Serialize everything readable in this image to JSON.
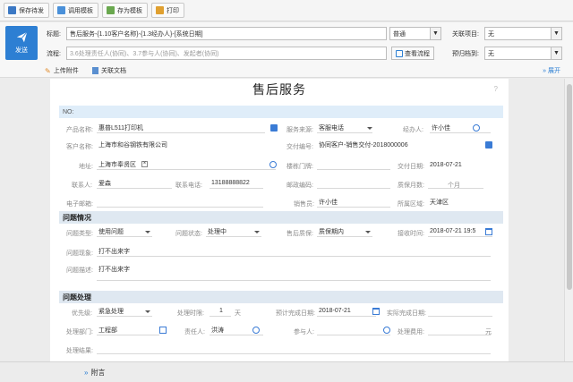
{
  "toolbar": {
    "save_draft": "保存待发",
    "use_template": "调用模板",
    "save_template": "存为模板",
    "print": "打印"
  },
  "header": {
    "send_label": "发送",
    "title_label": "标题:",
    "title_value": "售后服务-{1.10客户名称}-{1.3经办人}-[系统日期]",
    "priority_value": "普通",
    "related_project_label": "关联项目:",
    "related_project_value": "无",
    "flow_label": "流程:",
    "flow_placeholder": "3.6处理责任人(协同)、3.7参与人(协同)、发起者(协同)",
    "view_flow": "查看流程",
    "archive_label": "预归档到:",
    "archive_value": "无",
    "upload_attachment": "上传附件",
    "related_doc": "关联文档",
    "expand": "展开"
  },
  "form": {
    "title": "售后服务",
    "help": "?",
    "no_label": "NO:",
    "product_name_label": "产品名称:",
    "product_name": "惠普L511打印机",
    "service_source_label": "服务来源:",
    "service_source": "客服电话",
    "handler_label": "经办人:",
    "handler": "许小佳",
    "customer_name_label": "客户名称:",
    "customer_name": "上海市和谷钢铁有限公司",
    "delivery_no_label": "交付编号:",
    "delivery_no": "协同客户-销售交付-2018000006",
    "address_label": "地址:",
    "address": "上海市奉贤区",
    "building_label": "楼栋门牌:",
    "delivery_date_label": "交付日期:",
    "delivery_date": "2018-07-21",
    "contact_label": "联系人:",
    "contact": "爱森",
    "phone_label": "联系电话:",
    "phone": "13188888822",
    "postcode_label": "邮政编码:",
    "warranty_months_label": "质保月数:",
    "warranty_months_unit": "个月",
    "email_label": "电子邮箱:",
    "sales_label": "销售员:",
    "sales": "许小佳",
    "region_label": "所属区域:",
    "region": "天津区",
    "section_problem": "问题情况",
    "problem_type_label": "问题类型:",
    "problem_type": "使用问题",
    "problem_status_label": "问题状态:",
    "problem_status": "处理中",
    "after_sales_warranty_label": "售后质保:",
    "after_sales_warranty": "质保期内",
    "receive_time_label": "接收时间:",
    "receive_time": "2018-07-21 19:5",
    "phenomenon_label": "问题现象:",
    "phenomenon": "打不出来字",
    "description_label": "问题描述:",
    "description": "打不出来字",
    "section_processing": "问题处理",
    "priority_label": "优先级:",
    "priority": "紧急处理",
    "processing_time_label": "处理时限:",
    "processing_time": "1",
    "processing_time_unit": "天",
    "expected_date_label": "预计完成日期:",
    "expected_date": "2018-07-21",
    "actual_date_label": "实际完成日期:",
    "department_label": "处理部门:",
    "department": "工程部",
    "responsible_label": "责任人:",
    "responsible": "洪涛",
    "participant_label": "参与人:",
    "processing_cost_label": "处理费用:",
    "processing_cost_unit": "元",
    "result_label": "处理结果:"
  },
  "footer": {
    "fuyan": "附言"
  },
  "colors": {
    "accent": "#2d7fd3",
    "band": "#dfedf9",
    "section": "#dfe8f1"
  }
}
